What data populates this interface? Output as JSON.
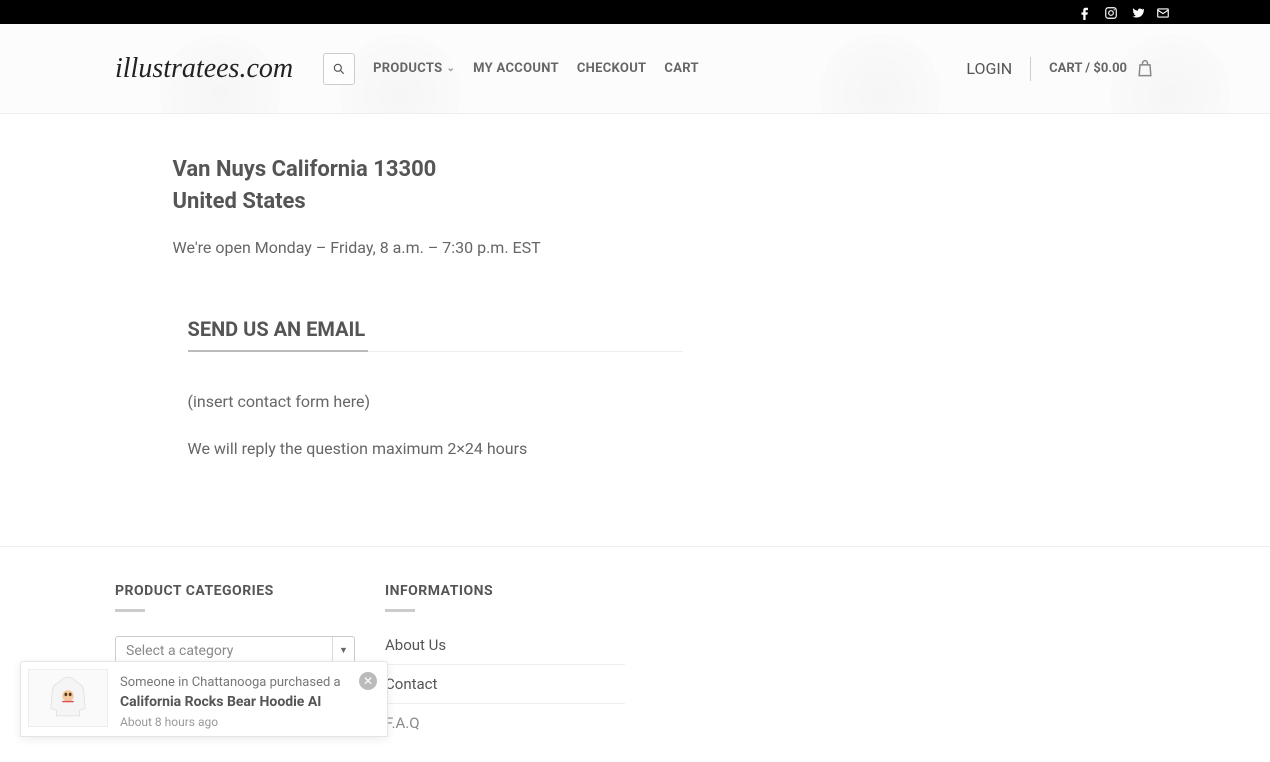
{
  "topbar": {
    "icons": [
      "facebook",
      "instagram",
      "twitter",
      "mail"
    ]
  },
  "header": {
    "logo": "illustratees.com",
    "menu": {
      "products": "PRODUCTS",
      "my_account": "MY ACCOUNT",
      "checkout": "CHECKOUT",
      "cart": "CART"
    },
    "right": {
      "login": "LOGIN",
      "cart_label": "CART / ",
      "cart_currency": "$",
      "cart_amount": "0.00"
    }
  },
  "main": {
    "address_line1": "Van Nuys California 13300",
    "address_line2": "United States",
    "hours": "We're open Monday – Friday, 8 a.m. – 7:30 p.m. EST",
    "email_heading": "SEND US AN EMAIL",
    "form_placeholder": "(insert contact form here)",
    "reply_note": "We will reply the question maximum 2×24 hours"
  },
  "footer": {
    "categories_heading": "PRODUCT CATEGORIES",
    "select_placeholder": "Select a category",
    "info_heading": "INFORMATIONS",
    "info_links": {
      "about": "About Us",
      "contact": "Contact",
      "faq": "F.A.Q"
    }
  },
  "sales_popup": {
    "line1_pre": "Someone in ",
    "line1_city": "Chattanooga",
    "line1_post": " purchased a",
    "product": "California Rocks Bear Hoodie AI",
    "time": "About 8 hours ago"
  }
}
